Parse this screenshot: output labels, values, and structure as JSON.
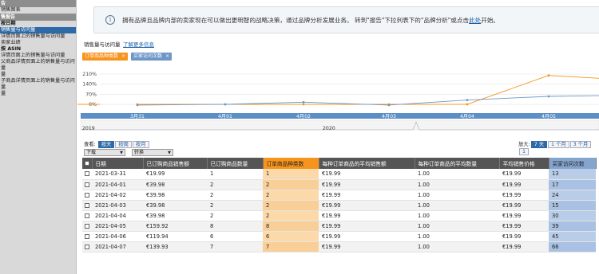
{
  "sidebar": {
    "items": [
      {
        "label": "告",
        "type": "sec"
      },
      {
        "label": "销售图表",
        "type": "it"
      },
      {
        "label": "售报告",
        "type": "sec"
      },
      {
        "label": "按日期",
        "type": "grp"
      },
      {
        "label": "销售量与访问量",
        "type": "sel"
      },
      {
        "label": "详情页面上的销售量与访问量",
        "type": "it"
      },
      {
        "label": "卖家业绩",
        "type": "it"
      },
      {
        "label": "按 ASIN",
        "type": "grp"
      },
      {
        "label": "详情页面上的销售量与访问量",
        "type": "it"
      },
      {
        "label": "父商品详情页面上的销售量与访问量",
        "type": "it"
      },
      {
        "label": "量",
        "type": "it"
      },
      {
        "label": "子商品详情页面上的销售量与访问量",
        "type": "it"
      },
      {
        "label": "量",
        "type": "it"
      }
    ]
  },
  "notice": {
    "icon": "info-icon",
    "text": "拥有品牌且品牌内部的卖家现在可以做出更明智的战略决策，通过品牌分析发展业务。 转到\"报告\"下拉列表下的\"品牌分析\"或点击",
    "link": "此处",
    "after": "开始。"
  },
  "chart_header": {
    "label": "销售量与访问量",
    "learn_more": "了解更多信息"
  },
  "chips": [
    {
      "label": "订单商品种类数",
      "close": "×",
      "color": "#f7941d"
    },
    {
      "label": "买家访问次数",
      "close": "×",
      "color": "#6e97c8"
    }
  ],
  "chart_data": {
    "type": "line",
    "x": [
      "3月31",
      "4月01",
      "4月02",
      "4月03",
      "4月04",
      "4月05"
    ],
    "ylabels": [
      "210%",
      "140%",
      "70%",
      "0%"
    ],
    "series": [
      {
        "name": "订单商品种类数",
        "color": "#f7941d",
        "values": [
          0,
          0,
          0,
          0,
          0,
          200
        ]
      },
      {
        "name": "买家访问次数",
        "color": "#6e97c8",
        "values": [
          -5,
          0,
          15,
          -5,
          30,
          55
        ]
      }
    ],
    "timeline": {
      "years": [
        "2019",
        "2020"
      ]
    }
  },
  "toolbar": {
    "view_label": "查看:",
    "view_buttons": [
      "按天",
      "按周",
      "按月"
    ],
    "zoom_label": "放大:",
    "zoom_buttons": [
      "7 天",
      "1 个月",
      "3 个月",
      "1"
    ]
  },
  "filters": {
    "download": "下载",
    "convert": "转换"
  },
  "table": {
    "headers": [
      "日期",
      "已订购商品销售额",
      "已订购商品数量",
      "订单商品种类数",
      "每种订单商品的平均销售额",
      "每种订单商品的平均数量",
      "平均销售价格",
      "买家访问次数"
    ],
    "rows": [
      [
        "2021-03-31",
        "€19.99",
        "1",
        "1",
        "€19.99",
        "1.00",
        "€19.99",
        "13"
      ],
      [
        "2021-04-01",
        "€39.98",
        "2",
        "2",
        "€19.99",
        "1.00",
        "€19.99",
        "17"
      ],
      [
        "2021-04-02",
        "€39.98",
        "2",
        "2",
        "€19.99",
        "1.00",
        "€19.99",
        "24"
      ],
      [
        "2021-04-03",
        "€39.98",
        "2",
        "2",
        "€19.99",
        "1.00",
        "€19.99",
        "15"
      ],
      [
        "2021-04-04",
        "€39.98",
        "2",
        "2",
        "€19.99",
        "1.00",
        "€19.99",
        "30"
      ],
      [
        "2021-04-05",
        "€159.92",
        "8",
        "8",
        "€19.99",
        "1.00",
        "€19.99",
        "39"
      ],
      [
        "2021-04-06",
        "€119.94",
        "6",
        "6",
        "€19.99",
        "1.00",
        "€19.99",
        "45"
      ],
      [
        "2021-04-07",
        "€139.93",
        "7",
        "7",
        "€19.99",
        "1.00",
        "€19.99",
        "66"
      ]
    ]
  }
}
